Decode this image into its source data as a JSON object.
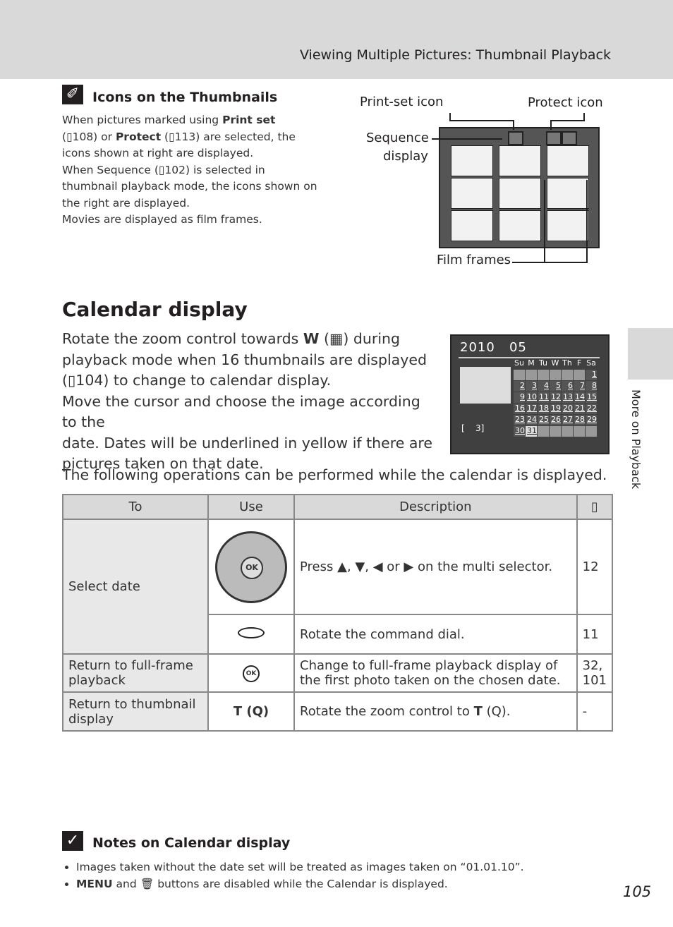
{
  "header": {
    "title": "Viewing Multiple Pictures: Thumbnail Playback"
  },
  "side_tab": {
    "label": "More on Playback"
  },
  "icons_note": {
    "icon": "note-icon",
    "title": "Icons on the Thumbnails",
    "lines": [
      [
        "When pictures marked using ",
        "Print set"
      ],
      [
        "(",
        "108) or ",
        "Protect",
        " (",
        "113) are selected, the"
      ],
      "icons shown at right are displayed.",
      [
        "When Sequence (",
        "102) is selected in"
      ],
      "thumbnail playback mode, the icons shown on",
      "the right are displayed.",
      "Movies are displayed as film frames."
    ],
    "labels": {
      "print_set": "Print-set icon",
      "protect": "Protect icon",
      "sequence1": "Sequence",
      "sequence2": "display",
      "film": "Film frames"
    }
  },
  "calendar": {
    "title": "Calendar display",
    "para1": [
      "Rotate the zoom control towards ",
      "W",
      " (",
      ") during",
      "playback mode when 16 thumbnails are displayed",
      "(",
      "104) to change to calendar display."
    ],
    "para2": [
      "Move the cursor and choose the image according to the",
      "date. Dates will be underlined in yellow if there are",
      "pictures taken on that date."
    ],
    "screen": {
      "year": "2010",
      "month": "05",
      "count": "[    3]",
      "weekdays": [
        "Su",
        "M",
        "Tu",
        "W",
        "Th",
        "F",
        "Sa"
      ],
      "selected_day": 31,
      "first_weekday": 6,
      "days_in_month": 31
    },
    "ops_intro": "The following operations can be performed while the calendar is displayed."
  },
  "table": {
    "headers": [
      "To",
      "Use",
      "Description"
    ],
    "rows": [
      {
        "to": "Select date",
        "use": "multi-selector",
        "desc": [
          "Press ",
          "▲",
          ", ",
          "▼",
          ", ",
          "◀",
          " or ",
          "▶",
          " on the multi selector."
        ],
        "ref": "12"
      },
      {
        "use": "command-dial",
        "desc": "Rotate the command dial.",
        "ref": "11"
      },
      {
        "to": "Return to full-frame playback",
        "use": "OK",
        "desc": "Change to full-frame playback display of the first photo taken on the chosen date.",
        "ref": "32, 101"
      },
      {
        "to": "Return to thumbnail display",
        "use": "T (Q)",
        "desc": [
          "Rotate the zoom control to ",
          "T",
          " (",
          ")."
        ],
        "ref": "-"
      }
    ]
  },
  "notes": {
    "title": "Notes on Calendar display",
    "items": [
      "Images taken without the date set will be treated as images taken on “01.01.10”.",
      [
        "MENU",
        " and ",
        "🗑",
        " buttons are disabled while the Calendar is displayed."
      ]
    ]
  },
  "page_number": "105"
}
